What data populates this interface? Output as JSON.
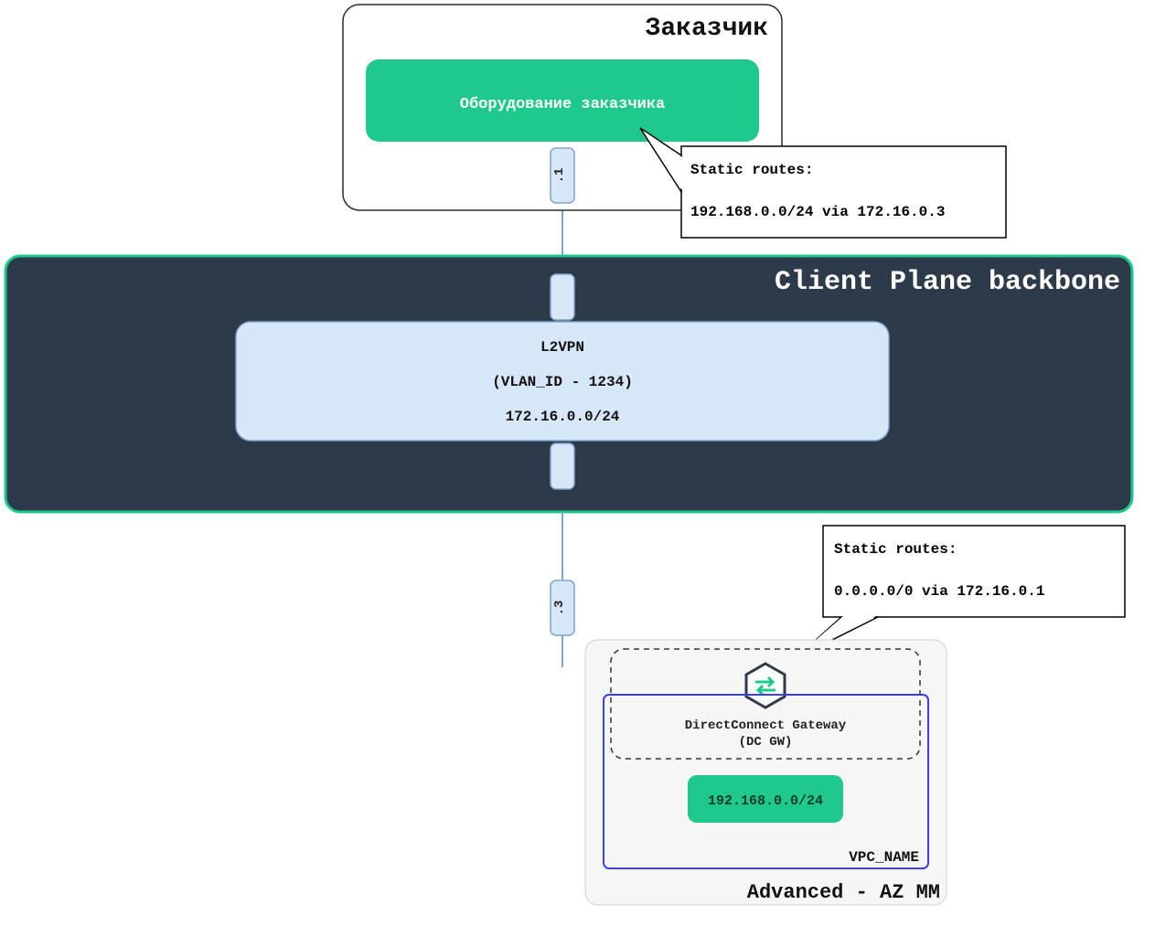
{
  "customer": {
    "title": "Заказчик",
    "equipment_label": "Оборудование заказчика"
  },
  "routes_top": {
    "title": "Static routes:",
    "line": "192.168.0.0/24 via 172.16.0.3"
  },
  "backbone": {
    "title": "Client Plane backbone",
    "l2vpn": {
      "label": "L2VPN",
      "vlan": "(VLAN_ID - 1234)",
      "cidr": "172.16.0.0/24"
    }
  },
  "endpoints": {
    "top": ".1",
    "bottom": ".3"
  },
  "routes_bottom": {
    "title": "Static routes:",
    "line": "0.0.0.0/0 via 172.16.0.1"
  },
  "advanced": {
    "title": "Advanced - AZ MM",
    "dc_gw": {
      "line1": "DirectConnect Gateway",
      "line2": "(DC GW)"
    },
    "vpc": {
      "cidr": "192.168.0.0/24",
      "name": "VPC_NAME"
    }
  },
  "colors": {
    "green": "#1ec98b",
    "dark": "#2d3a49",
    "lightblue": "#d7e7f7",
    "blueborder": "#7fa6cc",
    "vpcborder": "#3d3df5",
    "greybg": "#f6f6f6"
  }
}
